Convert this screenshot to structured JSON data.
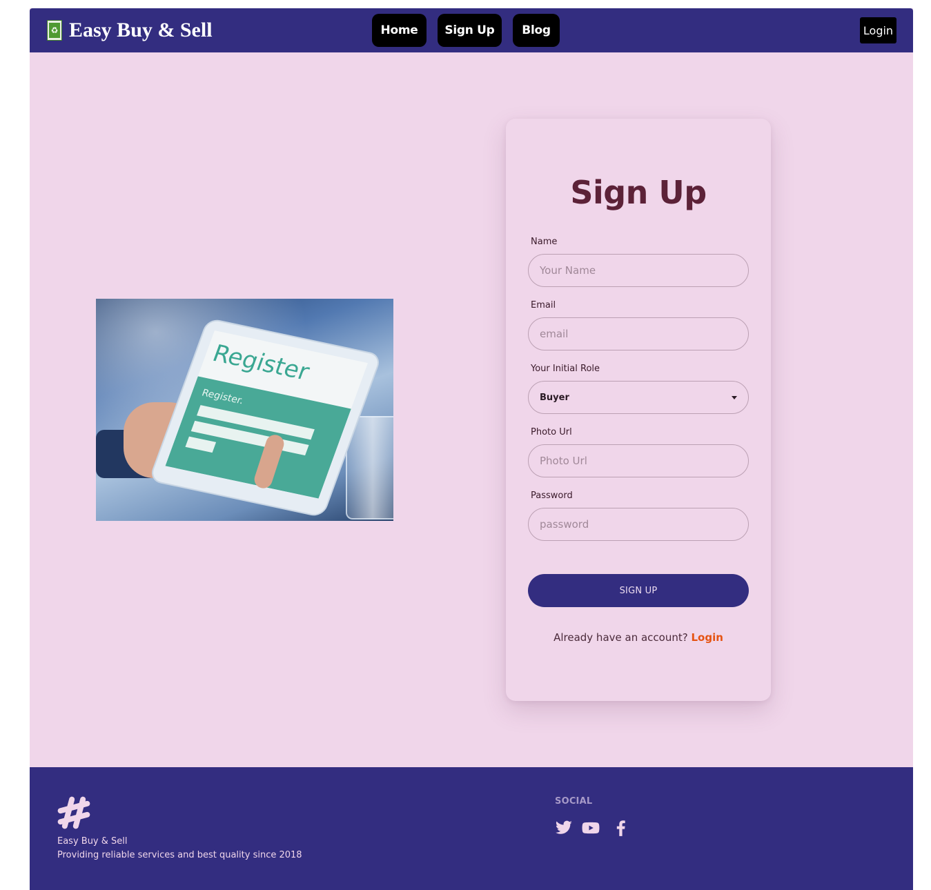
{
  "colors": {
    "navbar_bg": "#332d80",
    "page_bg": "#f0d6ea",
    "nav_button_bg": "#000000",
    "title_color": "#5c2238",
    "primary_button": "#332d80",
    "link_accent": "#e55312",
    "footer_bg": "#332d80"
  },
  "navbar": {
    "brand_logo_icon": "recycle-icon",
    "brand_name": "Easy Buy & Sell",
    "links": {
      "home": "Home",
      "signup": "Sign Up",
      "blog": "Blog"
    },
    "login_label": "Login"
  },
  "hero": {
    "image_icon": "tablet-register-photo"
  },
  "form": {
    "title": "Sign Up",
    "name": {
      "label": "Name",
      "placeholder": "Your Name",
      "value": ""
    },
    "email": {
      "label": "Email",
      "placeholder": "email",
      "value": ""
    },
    "role": {
      "label": "Your Initial Role",
      "selected": "Buyer"
    },
    "photo": {
      "label": "Photo Url",
      "placeholder": "Photo Url",
      "value": ""
    },
    "password": {
      "label": "Password",
      "placeholder": "password",
      "value": ""
    },
    "submit_label": "SIGN UP",
    "login_prompt": "Already have an account?",
    "login_link": "Login"
  },
  "footer": {
    "logo_icon": "hashtag-icon",
    "company_name": "Easy Buy & Sell",
    "tagline": "Providing reliable services and best quality since 2018",
    "social_title": "SOCIAL",
    "social_icons": [
      "twitter-icon",
      "youtube-icon",
      "facebook-icon"
    ]
  }
}
